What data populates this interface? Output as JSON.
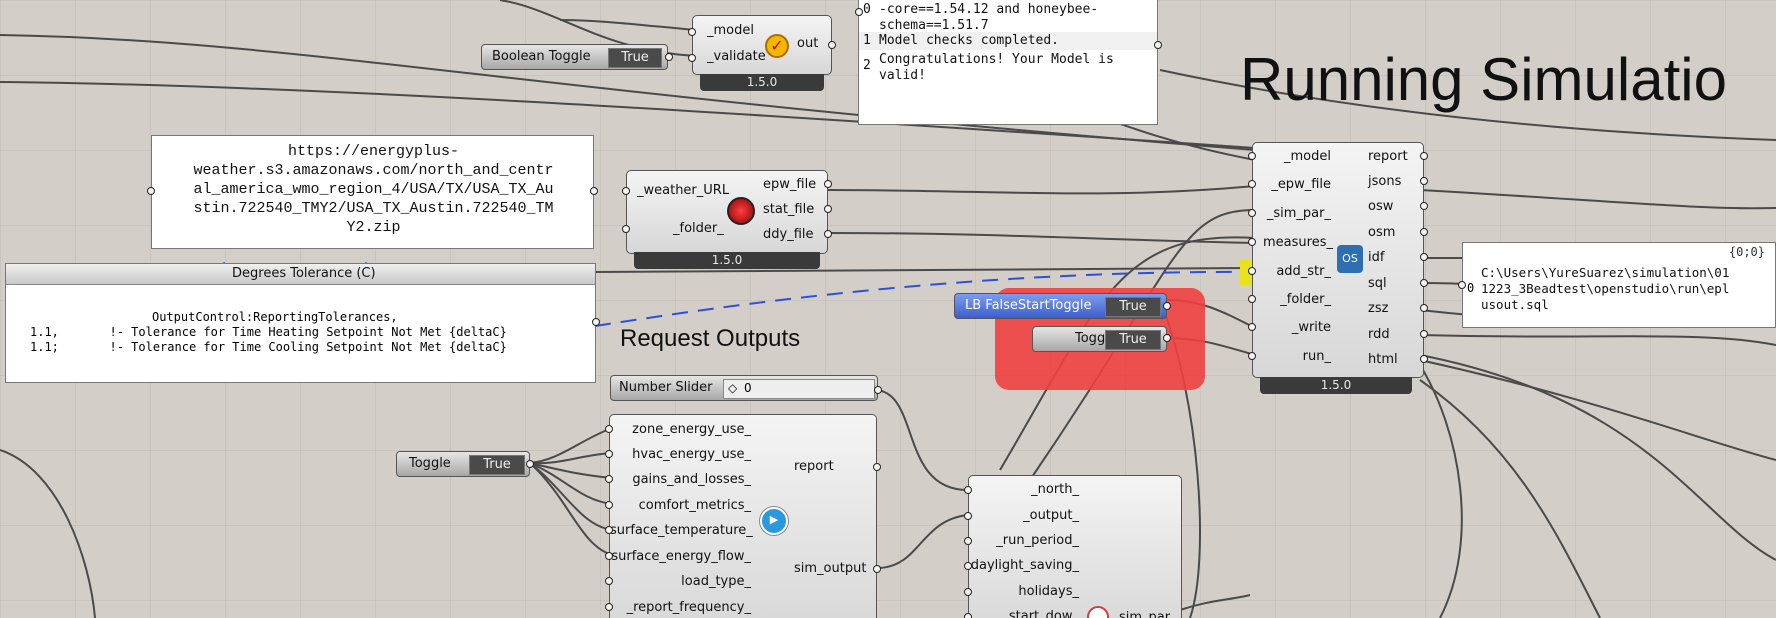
{
  "header": {
    "section_title": "Running Simulatio",
    "request_outputs_title": "Request Outputs"
  },
  "check_model": {
    "inputs": [
      "_model",
      "_validate"
    ],
    "output": "out",
    "version": "1.5.0"
  },
  "bool_toggle_top": {
    "label": "Boolean Toggle",
    "value": "True"
  },
  "model_check_panel": {
    "rows": [
      {
        "index": "0",
        "text": "-core==1.54.12 and honeybee-\nschema==1.51.7"
      },
      {
        "index": "1",
        "text": "Model checks completed."
      },
      {
        "index": "2",
        "text": "Congratulations! Your Model is\nvalid!"
      }
    ]
  },
  "weather_url_panel": {
    "text": "https://energyplus-\nweather.s3.amazonaws.com/north_and_centr\nal_america_wmo_region_4/USA/TX/USA_TX_Au\nstin.722540_TMY2/USA_TX_Austin.722540_TM\nY2.zip"
  },
  "download_weather": {
    "inputs": [
      "_weather_URL",
      "_folder_"
    ],
    "outputs": [
      "epw_file",
      "stat_file",
      "ddy_file"
    ],
    "version": "1.5.0"
  },
  "degrees_panel": {
    "title": "Degrees Tolerance (C)",
    "lines": [
      "OutputControl:ReportingTolerances,",
      "1.1,       !- Tolerance for Time Heating Setpoint Not Met {deltaC}",
      "1.1;       !- Tolerance for Time Cooling Setpoint Not Met {deltaC}"
    ]
  },
  "run_osm": {
    "inputs": [
      "_model",
      "_epw_file",
      "_sim_par_",
      "measures_",
      "add_str_",
      "_folder_",
      "_write",
      "run_"
    ],
    "outputs": [
      "report",
      "jsons",
      "osw",
      "osm",
      "idf",
      "sql",
      "zsz",
      "rdd",
      "html"
    ],
    "version": "1.5.0"
  },
  "lb_false_start": {
    "label": "LB FalseStartToggle",
    "value": "True"
  },
  "toggle_run": {
    "label": "Toggle",
    "value": "True"
  },
  "sql_panel": {
    "path_label": "{0;0}",
    "index": "0",
    "text": "C:\\Users\\YureSuarez\\simulation\\01\n1223_3Beadtest\\openstudio\\run\\epl\nusout.sql"
  },
  "number_slider": {
    "label": "Number Slider",
    "value": "0"
  },
  "toggle_outputs": {
    "label": "Toggle",
    "value": "True"
  },
  "sim_output": {
    "inputs": [
      "zone_energy_use_",
      "hvac_energy_use_",
      "gains_and_losses_",
      "comfort_metrics_",
      "surface_temperature_",
      "surface_energy_flow_",
      "load_type_",
      "_report_frequency_"
    ],
    "outputs": [
      "report",
      "sim_output"
    ]
  },
  "sim_par": {
    "inputs": [
      "_north_",
      "_output_",
      "_run_period_",
      "daylight_saving_",
      "holidays_",
      "start_dow_"
    ],
    "outputs": [
      "sim_par"
    ]
  },
  "colors": {
    "canvas": "#d3cfc8",
    "highlight": "#e8e21a",
    "red_group": "#ee4040",
    "blue_toggle": "#4d78e0",
    "wire_dashed": "#2f4fd8"
  }
}
